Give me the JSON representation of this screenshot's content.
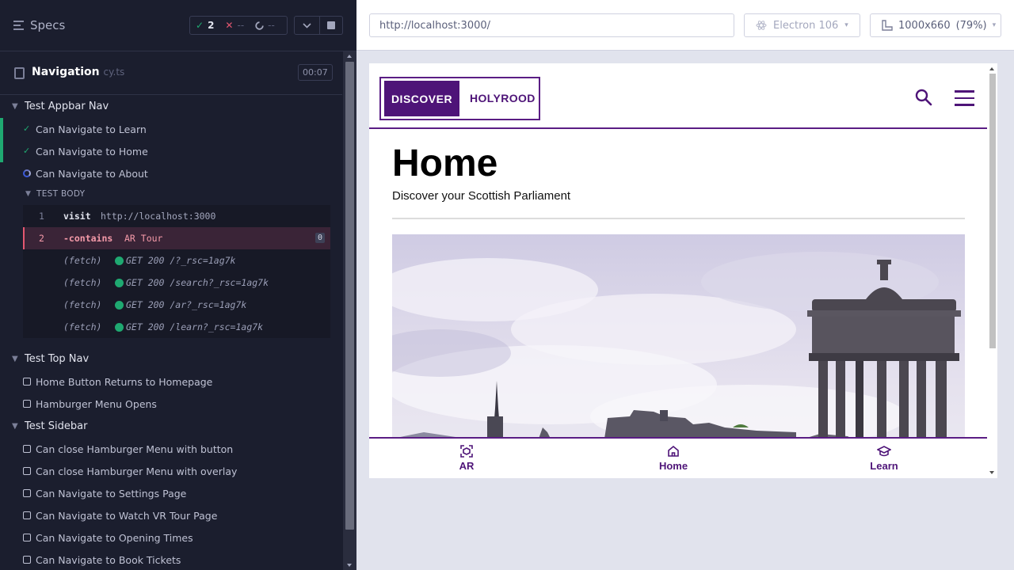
{
  "runner": {
    "specs_label": "Specs",
    "stats": {
      "passed": "2",
      "failed": "--",
      "pending": "--"
    },
    "spec": {
      "name": "Navigation",
      "ext": "cy.ts",
      "duration": "00:07"
    },
    "suites": [
      {
        "title": "Test Appbar Nav",
        "tests": [
          {
            "title": "Can Navigate to Learn",
            "state": "passed"
          },
          {
            "title": "Can Navigate to Home",
            "state": "passed"
          },
          {
            "title": "Can Navigate to About",
            "state": "running"
          }
        ]
      },
      {
        "title": "Test Top Nav",
        "tests": [
          {
            "title": "Home Button Returns to Homepage",
            "state": "pending"
          },
          {
            "title": "Hamburger Menu Opens",
            "state": "pending"
          }
        ]
      },
      {
        "title": "Test Sidebar",
        "tests": [
          {
            "title": "Can close Hamburger Menu with button",
            "state": "pending"
          },
          {
            "title": "Can close Hamburger Menu with overlay",
            "state": "pending"
          },
          {
            "title": "Can Navigate to Settings Page",
            "state": "pending"
          },
          {
            "title": "Can Navigate to Watch VR Tour Page",
            "state": "pending"
          },
          {
            "title": "Can Navigate to Opening Times",
            "state": "pending"
          },
          {
            "title": "Can Navigate to Book Tickets",
            "state": "pending"
          }
        ]
      }
    ],
    "test_body_label": "TEST BODY",
    "commands": [
      {
        "num": "1",
        "name": "visit",
        "arg": "http://localhost:3000"
      },
      {
        "num": "2",
        "name": "-contains",
        "arg": "AR Tour",
        "badge": "0",
        "state": "failed"
      }
    ],
    "fetches": [
      {
        "label": "(fetch)",
        "text": "GET 200 /?_rsc=1ag7k"
      },
      {
        "label": "(fetch)",
        "text": "GET 200 /search?_rsc=1ag7k"
      },
      {
        "label": "(fetch)",
        "text": "GET 200 /ar?_rsc=1ag7k"
      },
      {
        "label": "(fetch)",
        "text": "GET 200 /learn?_rsc=1ag7k"
      }
    ]
  },
  "browser": {
    "url": "http://localhost:3000/",
    "browser_name": "Electron 106",
    "viewport": "1000x660",
    "zoom": "(79%)"
  },
  "app": {
    "logo_discover": "DISCOVER",
    "logo_holyrood": "HOLYROOD",
    "title": "Home",
    "subtitle": "Discover your Scottish Parliament",
    "bottom_nav": [
      {
        "label": "AR",
        "icon": "ar-scan-icon"
      },
      {
        "label": "Home",
        "icon": "home-icon"
      },
      {
        "label": "Learn",
        "icon": "graduation-cap-icon"
      }
    ],
    "hero_image": "edinburgh-skyline-dugald-stewart-monument",
    "colors": {
      "brand": "#4e1478",
      "pass": "#1fa971",
      "fail": "#e45770"
    }
  }
}
